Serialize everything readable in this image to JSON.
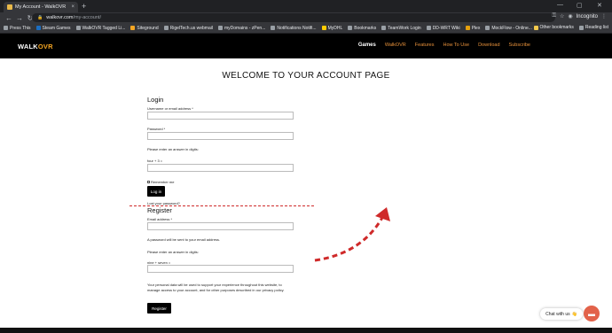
{
  "browser": {
    "tab_title": "My Account - WalkOVR",
    "tab_close": "×",
    "new_tab": "+",
    "win_min": "—",
    "win_max": "▢",
    "win_close": "✕",
    "back": "←",
    "forward": "→",
    "reload": "↻",
    "url_host": "walkovr.com",
    "url_path": "/my-account/",
    "incognito_label": "Incognito",
    "menu": "⋮",
    "bookmarks": [
      "Press This",
      "Steam Games",
      "WalkOVR Tagged Li...",
      "Siteground",
      "RigelTech.us webmail",
      "myDomains - zPen...",
      "Notifications Notifi...",
      "MyDHL",
      "Bookmarks",
      "TeamWork Login",
      "DD-WRT Wiki",
      "Plex",
      "MockFlow - Online..."
    ],
    "other_bookmarks": "Other bookmarks",
    "reading_list": "Reading list"
  },
  "site": {
    "logo_main": "WALK",
    "logo_accent": "OVR",
    "nav": [
      "Games",
      "WalkOVR",
      "Features",
      "How To Use",
      "Download",
      "Subscribe"
    ]
  },
  "page": {
    "title": "WELCOME TO YOUR ACCOUNT PAGE",
    "login": {
      "title": "Login",
      "username_label": "Username or email address *",
      "password_label": "Password *",
      "captcha_prompt": "Please enter an answer in digits:",
      "captcha_question": "four + 3 =",
      "remember_label": "Remember me",
      "login_button": "Log in",
      "lost_password": "Lost your password?"
    },
    "register": {
      "title": "Register",
      "email_label": "Email address *",
      "password_note": "A password will be sent to your email address.",
      "captcha_prompt": "Please enter an answer in digits:",
      "captcha_question": "nine + seven =",
      "privacy_text_1": "Your personal data will be used to support your experience throughout this website, to",
      "privacy_text_2": "manage access to your account, and for other purposes described in our privacy policy.",
      "register_button": "Register"
    }
  },
  "chat": {
    "label": "Chat with us",
    "emoji": "👋"
  },
  "colors": {
    "accent": "#e9923b",
    "annotation": "#cf2a2a",
    "chat": "#e2624a"
  }
}
